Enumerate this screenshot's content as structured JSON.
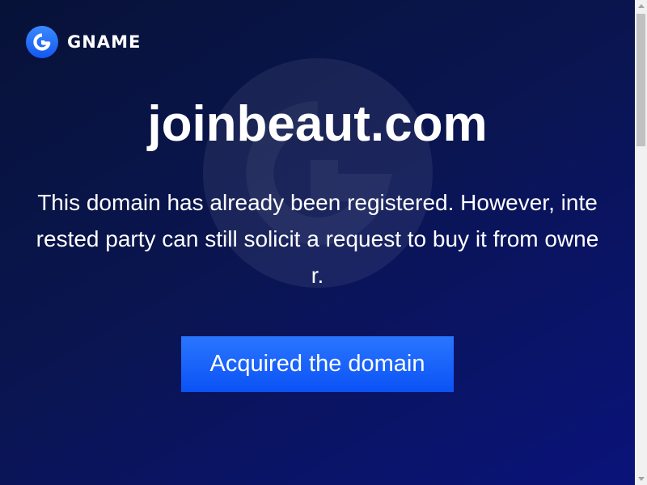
{
  "brand": {
    "name": "GNAME",
    "logo_icon": "gname-logo-icon"
  },
  "domain": "joinbeaut.com",
  "message": "This domain has already been registered. However, interested party can still solicit a request to buy it from owner.",
  "cta": {
    "label": "Acquired the domain"
  },
  "colors": {
    "background_start": "#071238",
    "background_end": "#0a137a",
    "button": "#1a63ff",
    "text": "#ffffff"
  }
}
